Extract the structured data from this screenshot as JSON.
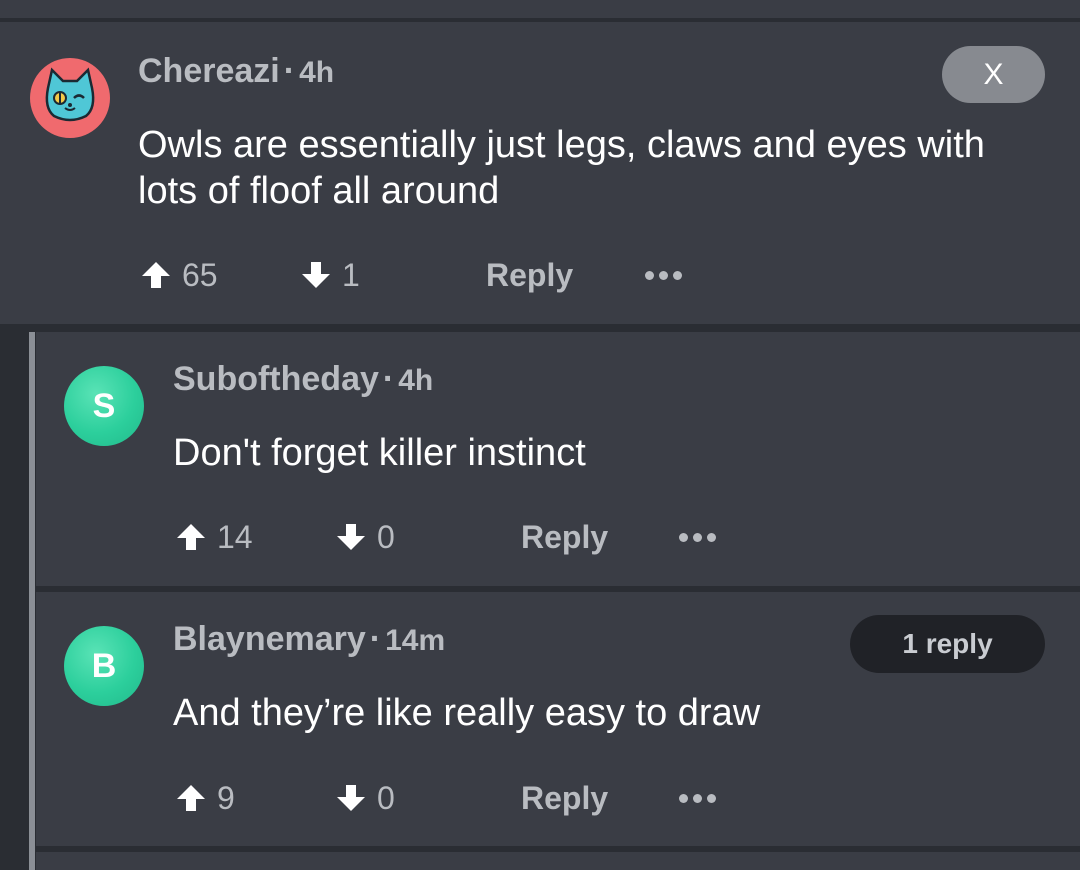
{
  "comments": [
    {
      "author": "Chereazi",
      "time": "4h",
      "avatar_icon": "cat-avatar-icon",
      "text_line1": "Owls are essentially just legs, claws and eyes with",
      "text_line2": "lots of floof all around",
      "upvotes": "65",
      "downvotes": "1",
      "reply_label": "Reply",
      "close_label": "X"
    },
    {
      "author": "Suboftheday",
      "time": "4h",
      "avatar_letter": "S",
      "text": "Don't forget killer instinct",
      "upvotes": "14",
      "downvotes": "0",
      "reply_label": "Reply"
    },
    {
      "author": "Blaynemary",
      "time": "14m",
      "avatar_letter": "B",
      "text": "And they’re like really easy to draw",
      "upvotes": "9",
      "downvotes": "0",
      "reply_label": "Reply",
      "replies_label": "1 reply"
    }
  ],
  "colors": {
    "background": "#2a2d33",
    "card": "#3a3d45",
    "avatar_green": "#2ccf9c",
    "avatar_red": "#f06a6e",
    "muted_text": "#b9bcc1"
  }
}
